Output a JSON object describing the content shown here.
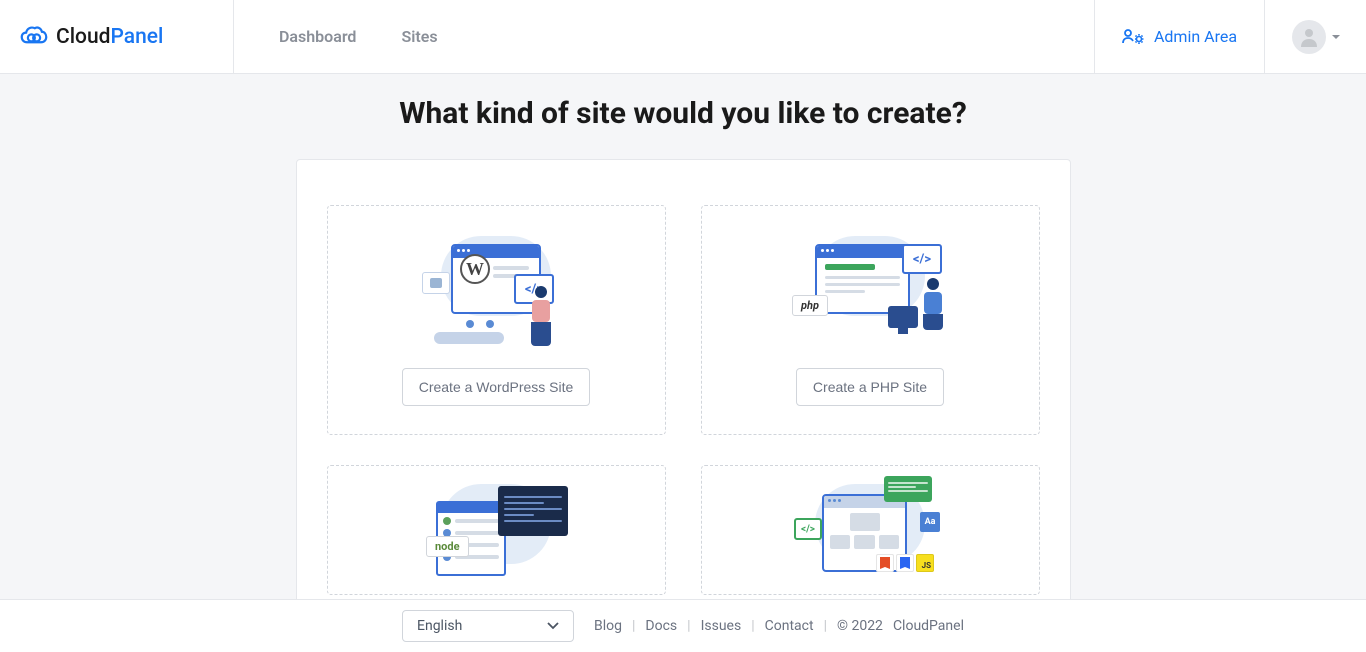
{
  "brand": {
    "cloud": "Cloud",
    "panel": "Panel"
  },
  "nav": {
    "dashboard": "Dashboard",
    "sites": "Sites"
  },
  "admin_area": "Admin Area",
  "page_title": "What kind of site would you like to create?",
  "options": {
    "wordpress": {
      "button": "Create a WordPress Site",
      "badge": "W"
    },
    "php": {
      "button": "Create a PHP Site",
      "badge": "php"
    },
    "node": {
      "badge": "node"
    },
    "static": {}
  },
  "footer": {
    "language": "English",
    "links": {
      "blog": "Blog",
      "docs": "Docs",
      "issues": "Issues",
      "contact": "Contact"
    },
    "copyright": "© 2022",
    "brand": "CloudPanel"
  }
}
